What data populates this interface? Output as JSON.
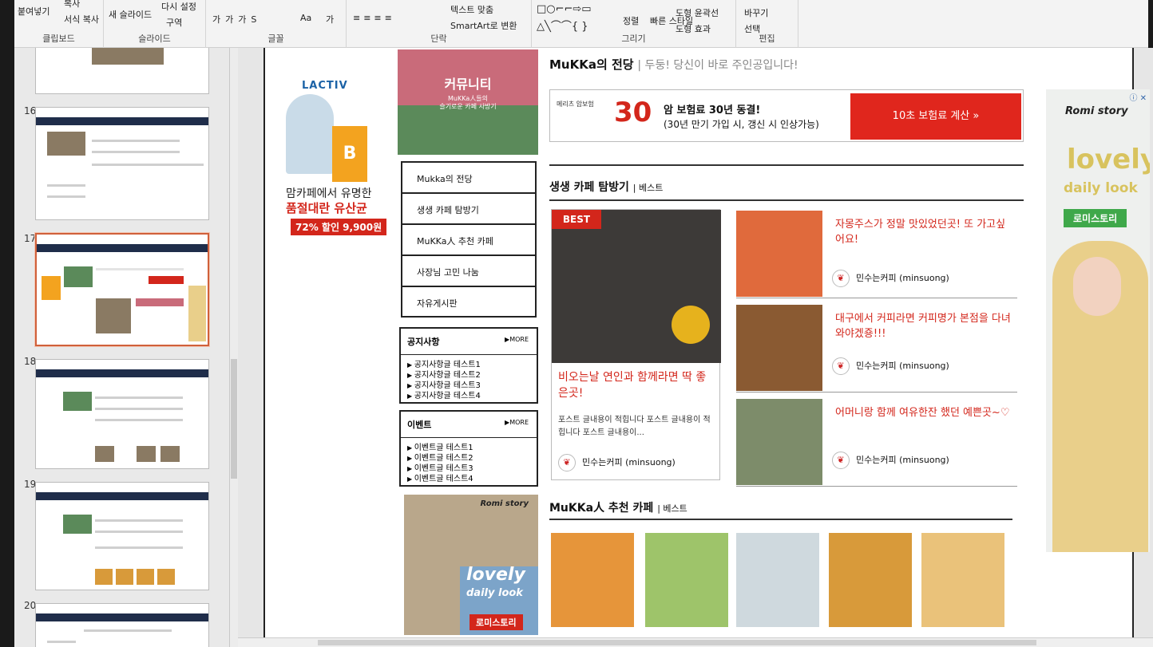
{
  "ribbon": {
    "clipboard": {
      "paste": "붙여넣기",
      "copy": "복사",
      "format_copy": "서식 복사",
      "label": "클립보드"
    },
    "slides": {
      "new_slide": "새 슬라이드",
      "reset": "다시 설정",
      "section": "구역",
      "label": "슬라이드"
    },
    "font": {
      "label": "글꼴",
      "font_size_sym": "가",
      "font_case": "Aa"
    },
    "paragraph": {
      "text_direction": "텍스트 맞춤",
      "smartart": "SmartArt로 변환",
      "label": "단락"
    },
    "drawing": {
      "arrange": "정렬",
      "quick_style": "빠른 스타일",
      "shape_outline": "도형 윤곽선",
      "shape_effect": "도형 효과",
      "label": "그리기"
    },
    "editing": {
      "replace": "바꾸기",
      "select": "선택",
      "label": "편집"
    }
  },
  "slide_panel": {
    "numbers": [
      "16",
      "17",
      "18",
      "19",
      "20"
    ],
    "selected": "17"
  },
  "slide": {
    "left_ad": {
      "brand": "LACTIV",
      "box": "B",
      "line1": "맘카페에서 유명한",
      "line2": "품절대란 유산균",
      "line3": "72% 할인 9,900원"
    },
    "community": {
      "title": "커뮤니티",
      "subtitle1": "MuKKa人들의",
      "subtitle2": "슬기로운 카페 사방기"
    },
    "menu": [
      "Mukka의 전당",
      "생생 카페 탐방기",
      "MuKKa人 추천 카페",
      "사장님 고민 나눔",
      "자유게시판"
    ],
    "notice": {
      "header": "공지사항",
      "more": "MORE",
      "items": [
        "공지사항글 테스트1",
        "공지사항글 테스트2",
        "공지사항글 테스트3",
        "공지사항글 테스트4"
      ]
    },
    "event": {
      "header": "이벤트",
      "more": "MORE",
      "items": [
        "이벤트글 테스트1",
        "이벤트글 테스트2",
        "이벤트글 테스트3",
        "이벤트글 테스트4"
      ]
    },
    "small_ad": {
      "brand": "Romi story",
      "lovely": "lovely",
      "daily": "daily look",
      "button": "로미스토리"
    },
    "title": {
      "main": "MuKKa의 전당",
      "sub": "| 두둥! 당신이 바로 주인공입니다!"
    },
    "banner": {
      "insurer": "메리츠 암보험",
      "num": "30",
      "line1": "암 보험료 30년 동결!",
      "line2": "(30년 만기 가입 시, 갱신 시 인상가능)",
      "cta": "10초 보험료 계산 »"
    },
    "section1": {
      "title": "생생 카페 탐방기",
      "tag": "| 베스트"
    },
    "big_card": {
      "badge": "BEST",
      "title": "비오는날 연인과 함께라면 딱 좋은곳!",
      "body": "포스트 글내용이 적힙니다 포스트 글내용이 적힙니다 포스트 글내용이...",
      "author": "민수는커피 (minsuong)"
    },
    "cards": [
      {
        "title": "자몽주스가 정말 맛있었던곳! 또 가고싶어요!",
        "author": "민수는커피 (minsuong)"
      },
      {
        "title": "대구에서 커피라면 커피명가 본점을 다녀와야겠죵!!!",
        "author": "민수는커피 (minsuong)"
      },
      {
        "title": "어머니랑 함께 여유한잔 했던 예쁜곳~♡",
        "author": "민수는커피 (minsuong)"
      }
    ],
    "section2": {
      "title": "MuKKa人 추천 카페",
      "tag": "| 베스트"
    },
    "right_ad": {
      "brand": "Romi story",
      "lovely": "lovely",
      "daily": "daily look",
      "button": "로미스토리",
      "close": "ⓘ ✕"
    }
  },
  "colors": {
    "accent_red": "#d3261b",
    "nav_dark": "#1f2d4a",
    "green": "#3fa84a"
  }
}
